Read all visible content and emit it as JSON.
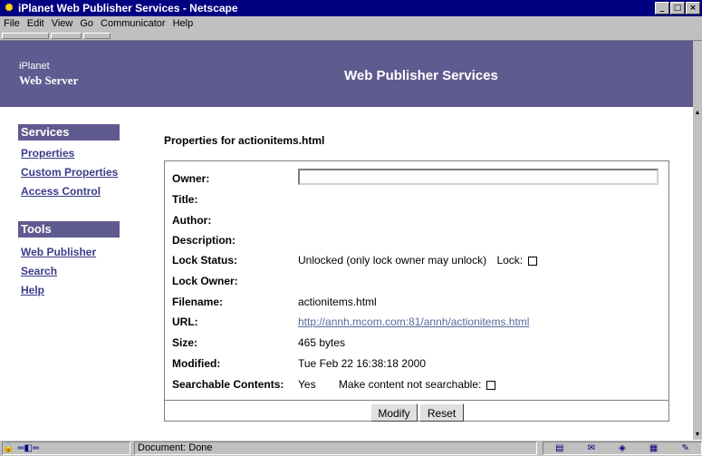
{
  "window": {
    "title": "iPlanet Web Publisher Services - Netscape",
    "controls": {
      "minimize": "_",
      "maximize": "□",
      "close": "×"
    }
  },
  "menubar": {
    "items": [
      {
        "label": "File"
      },
      {
        "label": "Edit"
      },
      {
        "label": "View"
      },
      {
        "label": "Go"
      },
      {
        "label": "Communicator"
      },
      {
        "label": "Help"
      }
    ]
  },
  "header": {
    "logo_line1": "iPlanet",
    "logo_line2": "Web Server",
    "banner": "Web Publisher Services"
  },
  "sidebar": {
    "services_heading": "Services",
    "services_links": [
      "Properties",
      "Custom Properties",
      "Access Control"
    ],
    "tools_heading": "Tools",
    "tools_links": [
      "Web Publisher",
      "Search",
      "Help"
    ]
  },
  "properties": {
    "title": "Properties for actionitems.html",
    "owner_label": "Owner:",
    "owner_value": "",
    "title_label": "Title:",
    "author_label": "Author:",
    "description_label": "Description:",
    "lock_status_label": "Lock Status:",
    "lock_status_value": "Unlocked (only lock owner may unlock)",
    "lock_label": "Lock:",
    "lock_checked": false,
    "lock_owner_label": "Lock Owner:",
    "filename_label": "Filename:",
    "filename_value": "actionitems.html",
    "url_label": "URL:",
    "url_value": "http://annh.mcom.com:81/annh/actionitems.html",
    "size_label": "Size:",
    "size_value": "465 bytes",
    "modified_label": "Modified:",
    "modified_value": "Tue Feb 22 16:38:18 2000",
    "searchable_label": "Searchable Contents:",
    "searchable_value": "Yes",
    "not_searchable_label": "Make content not searchable:",
    "not_searchable_checked": false,
    "modify_button": "Modify",
    "reset_button": "Reset"
  },
  "statusbar": {
    "text": "Document: Done"
  },
  "colors": {
    "titlebar": "#000080",
    "header_band": "#5f5a8f",
    "link": "#3b3c8a"
  }
}
